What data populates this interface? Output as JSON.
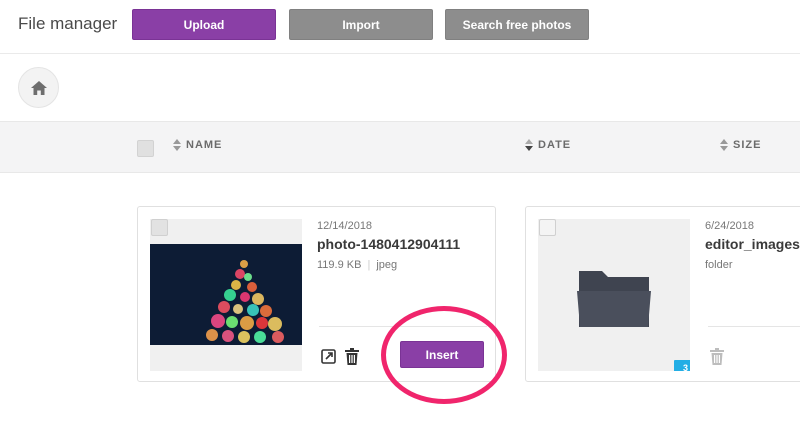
{
  "app": {
    "title": "File manager"
  },
  "toolbar": {
    "upload_label": "Upload",
    "import_label": "Import",
    "search_label": "Search free photos"
  },
  "columns": {
    "name": "NAME",
    "date": "DATE",
    "size": "SIZE"
  },
  "files": [
    {
      "date": "12/14/2018",
      "name": "photo-1480412904111",
      "size": "119.9 KB",
      "type": "jpeg",
      "insert_label": "Insert"
    },
    {
      "date": "6/24/2018",
      "name": "editor_images",
      "type": "folder",
      "count": "3"
    }
  ],
  "colors": {
    "accent": "#8a3fa6",
    "secondary": "#8d8d8d",
    "badge": "#23aee5",
    "highlight": "#f0256c"
  },
  "icons": [
    "home-icon",
    "sort-icon",
    "open-external-icon",
    "trash-icon",
    "folder-icon"
  ]
}
